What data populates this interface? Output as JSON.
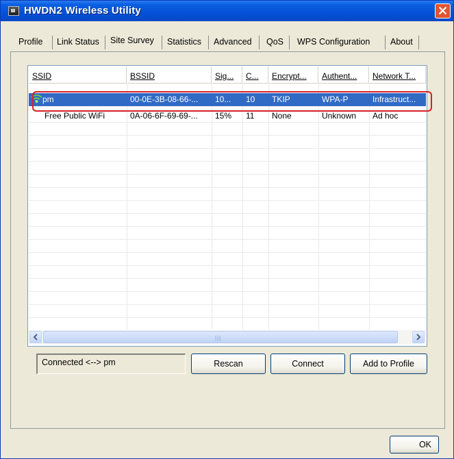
{
  "window": {
    "title": "HWDN2 Wireless Utility"
  },
  "tabs": [
    {
      "label": "Profile"
    },
    {
      "label": "Link Status"
    },
    {
      "label": "Site Survey",
      "active": true
    },
    {
      "label": "Statistics"
    },
    {
      "label": "Advanced"
    },
    {
      "label": "QoS"
    },
    {
      "label": "WPS Configuration"
    },
    {
      "label": "About"
    }
  ],
  "site_survey": {
    "columns": [
      "SSID",
      "BSSID",
      "Sig...",
      "C...",
      "Encrypt...",
      "Authent...",
      "Network T..."
    ],
    "rows": [
      {
        "ssid": "pm",
        "bssid": "00-0E-3B-08-66-...",
        "signal": "10...",
        "channel": "10",
        "encryption": "TKIP",
        "authentication": "WPA-P",
        "network_type": "Infrastruct...",
        "selected": true,
        "connected_icon": "network-connected-icon"
      },
      {
        "ssid": "Free Public WiFi",
        "bssid": "0A-06-6F-69-69-...",
        "signal": "15%",
        "channel": "11",
        "encryption": "None",
        "authentication": "Unknown",
        "network_type": "Ad hoc",
        "selected": false
      }
    ],
    "status_text": "Connected <--> pm",
    "buttons": {
      "rescan": "Rescan",
      "connect": "Connect",
      "add_to_profile": "Add to Profile"
    }
  },
  "footer": {
    "ok_label": "OK"
  },
  "colors": {
    "titlebar": "#0551d8",
    "selection": "#316ac5",
    "highlight_outline": "#d81f2a"
  }
}
